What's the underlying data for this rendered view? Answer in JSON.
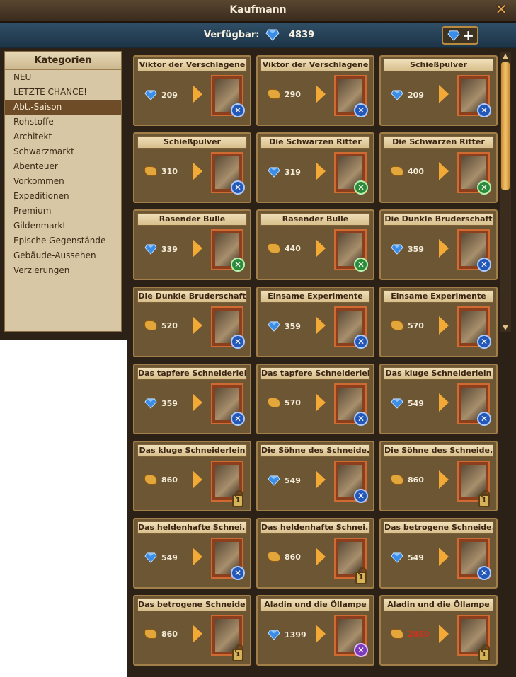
{
  "window": {
    "title": "Kaufmann",
    "close_icon": "close-icon"
  },
  "availability": {
    "label": "Verfügbar:",
    "value": "4839",
    "currency_icon": "diamond-icon",
    "add_icon": "plus-icon"
  },
  "sidebar": {
    "header": "Kategorien",
    "items": [
      {
        "label": "NEU"
      },
      {
        "label": "LETZTE CHANCE!"
      },
      {
        "label": "Abt.-Saison"
      },
      {
        "label": "Rohstoffe"
      },
      {
        "label": "Architekt"
      },
      {
        "label": "Schwarzmarkt"
      },
      {
        "label": "Abenteuer"
      },
      {
        "label": "Vorkommen"
      },
      {
        "label": "Expeditionen"
      },
      {
        "label": "Premium"
      },
      {
        "label": "Gildenmarkt"
      },
      {
        "label": "Epische Gegenstände"
      },
      {
        "label": "Gebäude-Aussehen"
      },
      {
        "label": "Verzierungen"
      }
    ],
    "active_index": 2
  },
  "offers": [
    {
      "name": "Viktor der Verschlagene",
      "currency": "diamond",
      "price": "209",
      "badge": "blue",
      "locked": false
    },
    {
      "name": "Viktor der Verschlagene",
      "currency": "coin",
      "price": "290",
      "badge": "blue",
      "locked": false
    },
    {
      "name": "Schießpulver",
      "currency": "diamond",
      "price": "209",
      "badge": "blue",
      "locked": false
    },
    {
      "name": "Schießpulver",
      "currency": "coin",
      "price": "310",
      "badge": "blue",
      "locked": false
    },
    {
      "name": "Die Schwarzen Ritter",
      "currency": "diamond",
      "price": "319",
      "badge": "green",
      "locked": false
    },
    {
      "name": "Die Schwarzen Ritter",
      "currency": "coin",
      "price": "400",
      "badge": "green",
      "locked": false
    },
    {
      "name": "Rasender Bulle",
      "currency": "diamond",
      "price": "339",
      "badge": "green",
      "locked": false
    },
    {
      "name": "Rasender Bulle",
      "currency": "coin",
      "price": "440",
      "badge": "green",
      "locked": false
    },
    {
      "name": "Die Dunkle Bruderschaft",
      "currency": "diamond",
      "price": "359",
      "badge": "blue",
      "locked": false
    },
    {
      "name": "Die Dunkle Bruderschaft",
      "currency": "coin",
      "price": "520",
      "badge": "blue",
      "locked": false
    },
    {
      "name": "Einsame Experimente",
      "currency": "diamond",
      "price": "359",
      "badge": "blue",
      "locked": false
    },
    {
      "name": "Einsame Experimente",
      "currency": "coin",
      "price": "570",
      "badge": "blue",
      "locked": false
    },
    {
      "name": "Das tapfere Schneiderlein",
      "currency": "diamond",
      "price": "359",
      "badge": "blue",
      "locked": false
    },
    {
      "name": "Das tapfere Schneiderlein",
      "currency": "coin",
      "price": "570",
      "badge": "blue",
      "locked": false
    },
    {
      "name": "Das kluge Schneiderlein",
      "currency": "diamond",
      "price": "549",
      "badge": "blue",
      "locked": false
    },
    {
      "name": "Das kluge Schneiderlein",
      "currency": "coin",
      "price": "860",
      "badge": "none",
      "locked": true
    },
    {
      "name": "Die Söhne des Schneide...",
      "currency": "diamond",
      "price": "549",
      "badge": "blue",
      "locked": false
    },
    {
      "name": "Die Söhne des Schneide...",
      "currency": "coin",
      "price": "860",
      "badge": "none",
      "locked": true
    },
    {
      "name": "Das heldenhafte Schnei...",
      "currency": "diamond",
      "price": "549",
      "badge": "blue",
      "locked": false
    },
    {
      "name": "Das heldenhafte Schnei...",
      "currency": "coin",
      "price": "860",
      "badge": "none",
      "locked": true
    },
    {
      "name": "Das betrogene Schneide...",
      "currency": "diamond",
      "price": "549",
      "badge": "blue",
      "locked": false
    },
    {
      "name": "Das betrogene Schneide...",
      "currency": "coin",
      "price": "860",
      "badge": "none",
      "locked": true
    },
    {
      "name": "Aladin und die Öllampe",
      "currency": "diamond",
      "price": "1399",
      "badge": "purple",
      "locked": false
    },
    {
      "name": "Aladin und die Öllampe",
      "currency": "coin",
      "price": "2850",
      "badge": "none",
      "locked": true,
      "price_insufficient": true
    }
  ],
  "colors": {
    "panel_bg": "#2b2116",
    "card_bg": "#6d5634",
    "accent": "#f2a935",
    "insufficient": "#d0301e"
  }
}
